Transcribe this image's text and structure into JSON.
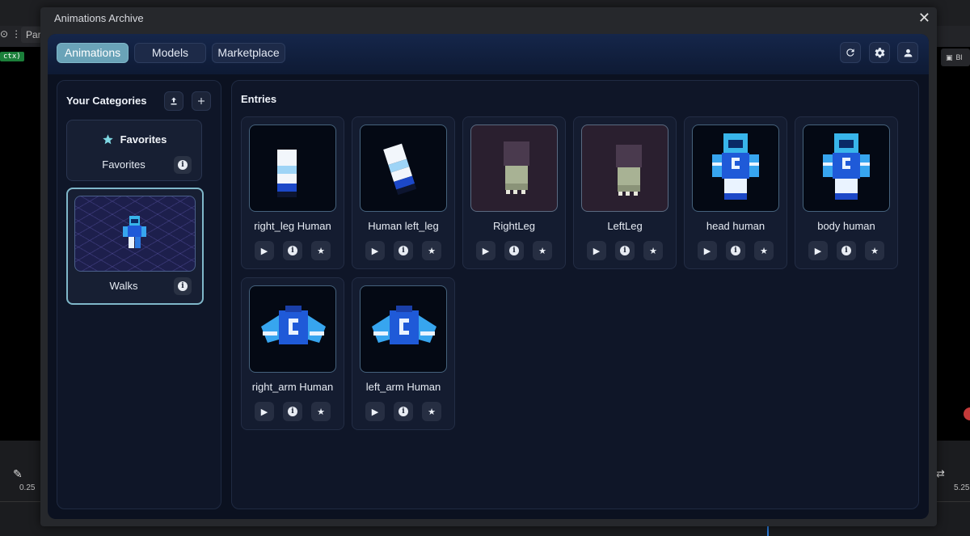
{
  "background": {
    "toolbar_pill": "Par",
    "context_badge": "ctx)",
    "right_button_label": "Bl",
    "timeline": {
      "left_value": "0.25",
      "right_value": "5.25"
    }
  },
  "modal": {
    "title": "Animations Archive",
    "close_label": "✕"
  },
  "header": {
    "tabs": [
      {
        "label": "Animations",
        "active": true
      },
      {
        "label": "Models",
        "active": false
      },
      {
        "label": "Marketplace",
        "active": false
      }
    ],
    "icons": [
      "refresh-icon",
      "gear-icon",
      "user-icon"
    ]
  },
  "categories": {
    "title": "Your Categories",
    "upload_icon": "upload-icon",
    "add_icon": "plus-icon",
    "items": [
      {
        "heading": "Favorites",
        "name": "Favorites",
        "icon": "star-icon",
        "selected": false
      },
      {
        "name": "Walks",
        "selected": true
      }
    ]
  },
  "entries": {
    "title": "Entries",
    "items": [
      {
        "label": "right_leg Human"
      },
      {
        "label": "Human left_leg"
      },
      {
        "label": "RightLeg"
      },
      {
        "label": "LeftLeg"
      },
      {
        "label": "head human"
      },
      {
        "label": "body human"
      },
      {
        "label": "right_arm Human"
      },
      {
        "label": "left_arm Human"
      }
    ],
    "actions": [
      "play-icon",
      "info-icon",
      "star-icon"
    ]
  },
  "colors": {
    "accent": "#6aa3b8",
    "selected_border": "#7fb7c9",
    "panel_bg": "#0f1628"
  }
}
